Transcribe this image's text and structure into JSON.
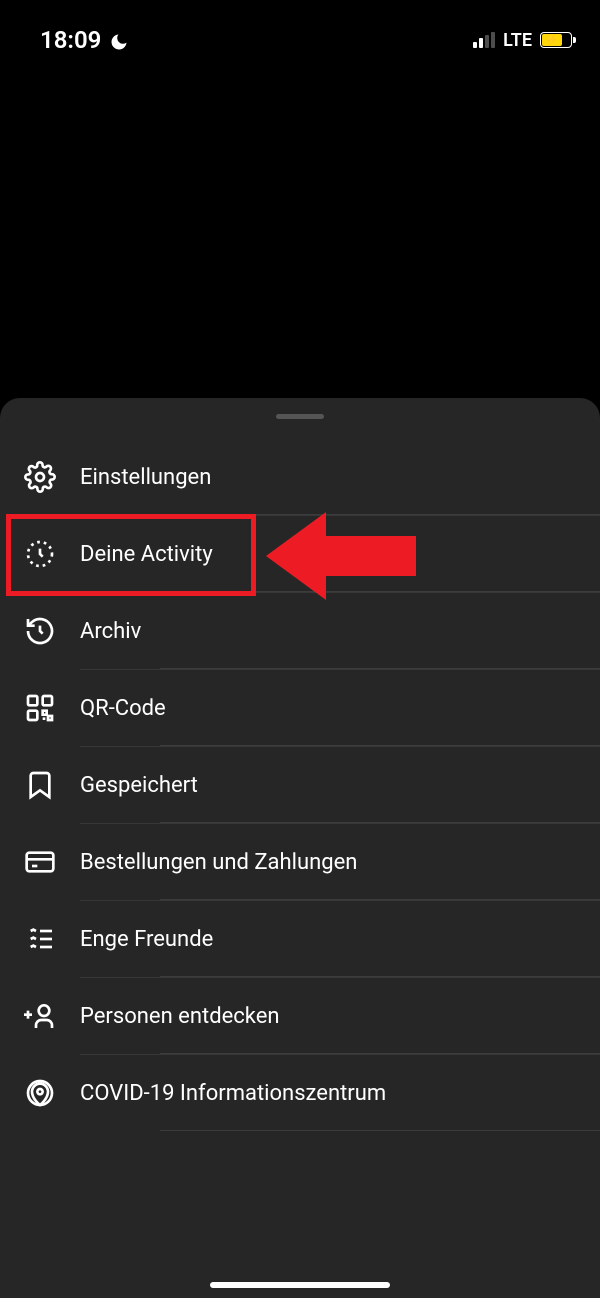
{
  "status": {
    "time": "18:09",
    "network": "LTE"
  },
  "menu": {
    "items": [
      {
        "id": "settings",
        "label": "Einstellungen",
        "icon": "gear-icon"
      },
      {
        "id": "activity",
        "label": "Deine Activity",
        "icon": "activity-icon"
      },
      {
        "id": "archive",
        "label": "Archiv",
        "icon": "archive-icon"
      },
      {
        "id": "qr",
        "label": "QR-Code",
        "icon": "qrcode-icon"
      },
      {
        "id": "saved",
        "label": "Gespeichert",
        "icon": "bookmark-icon"
      },
      {
        "id": "orders",
        "label": "Bestellungen und Zahlungen",
        "icon": "card-icon"
      },
      {
        "id": "close-friends",
        "label": "Enge Freunde",
        "icon": "closefriends-icon"
      },
      {
        "id": "discover",
        "label": "Personen entdecken",
        "icon": "discover-icon"
      },
      {
        "id": "covid",
        "label": "COVID-19 Informationszentrum",
        "icon": "covid-icon"
      }
    ]
  },
  "annotation": {
    "highlight_color": "#ed1c24",
    "highlighted_index": 1
  }
}
